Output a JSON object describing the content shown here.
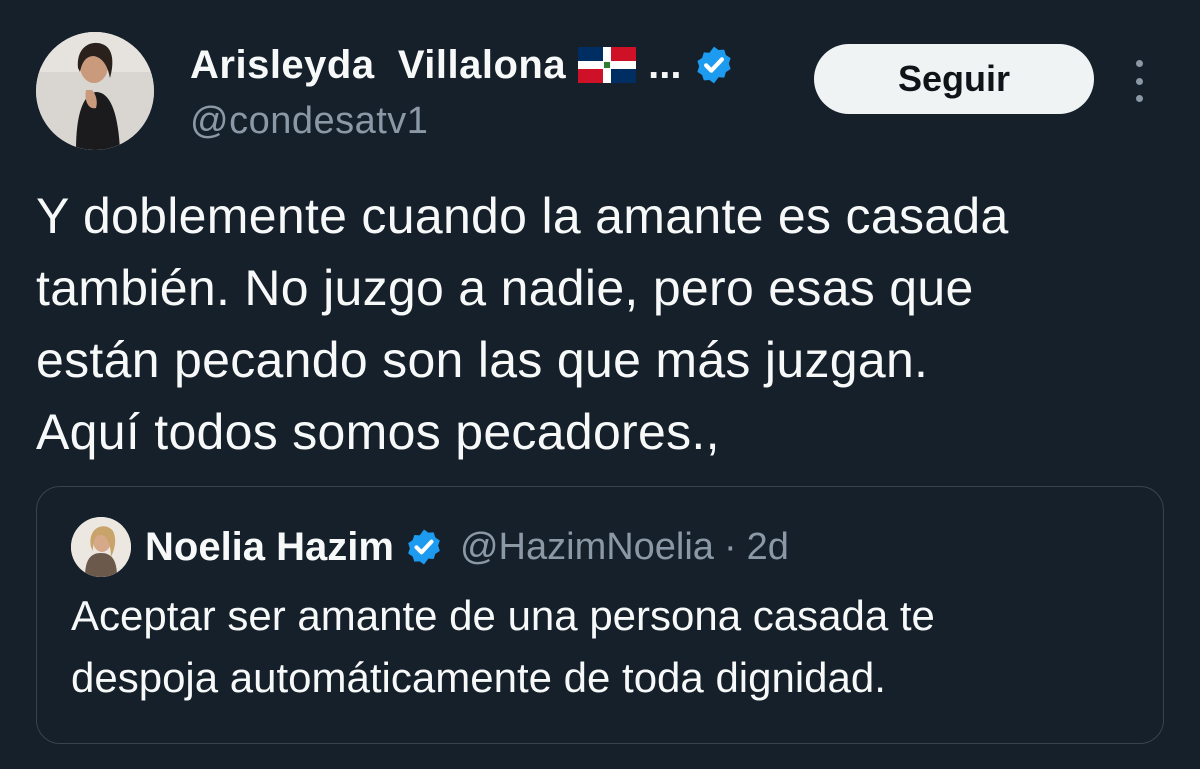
{
  "tweet": {
    "author_name": "Arisleyda  Villalona",
    "name_truncation": "...",
    "author_handle": "@condesatv1",
    "follow_label": "Seguir",
    "text": "Y doblemente cuando la amante es casada\ntambién. No juzgo a nadie, pero esas que\nestán pecando son las que más juzgan.\nAquí todos somos pecadores.,",
    "icons": [
      "dominican-flag-emoji",
      "verified-badge-icon",
      "more-options-icon"
    ]
  },
  "quoted_tweet": {
    "author_name": "Noelia Hazim",
    "author_handle": "@HazimNoelia",
    "separator": "·",
    "time": "2d",
    "text": "Aceptar ser amante de una persona casada te\ndespoja automáticamente de toda dignidad."
  },
  "colors": {
    "background": "#15202b",
    "text_primary": "#f7f9f9",
    "text_secondary": "#8b98a5",
    "verified_blue": "#1d9bf0",
    "follow_button_bg": "#eff3f4",
    "border": "#38444d"
  }
}
